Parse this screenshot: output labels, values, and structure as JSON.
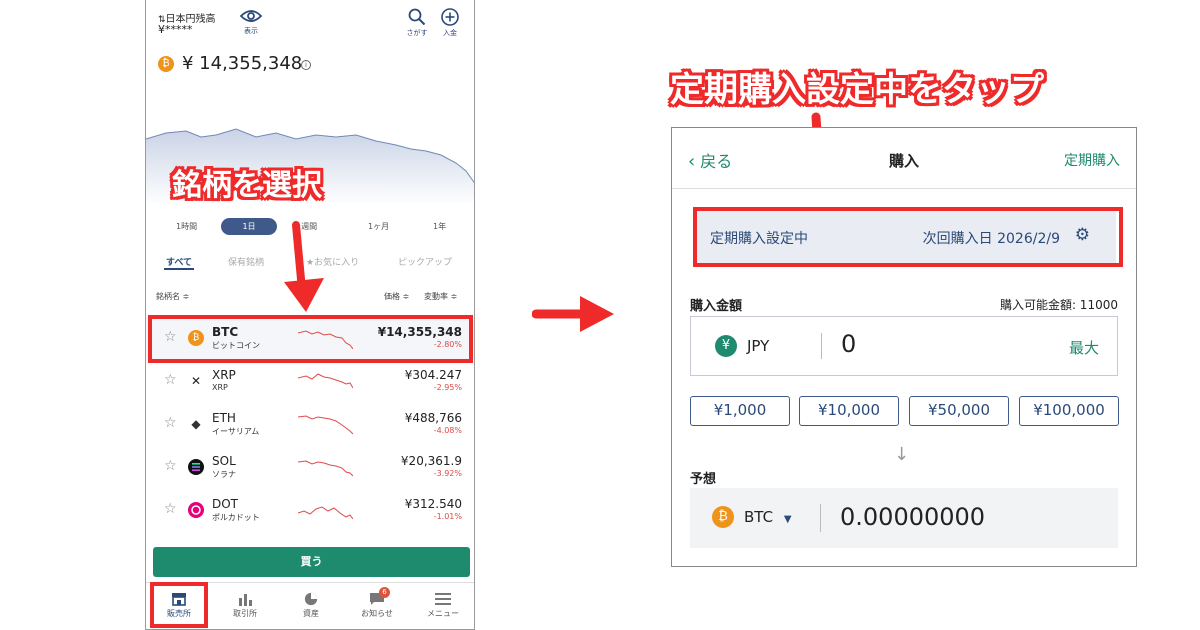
{
  "left_app": {
    "balance_label": "日本円残高",
    "balance_value": "¥*****",
    "show_label": "表示",
    "search_label": "さがす",
    "deposit_label": "入金",
    "total_value": "¥ 14,355,348",
    "timeframes": [
      "1時間",
      "1日",
      "1週間",
      "1ヶ月",
      "1年"
    ],
    "active_timeframe": "1日",
    "filters": [
      "すべて",
      "保有銘柄",
      "★お気に入り",
      "ピックアップ"
    ],
    "col_name": "銘柄名 ≑",
    "col_price": "価格 ≑",
    "col_change": "変動率 ≑",
    "coins": [
      {
        "symbol": "BTC",
        "name": "ビットコイン",
        "price": "¥14,355,348",
        "change": "-2.80%",
        "color": "#f0931a"
      },
      {
        "symbol": "XRP",
        "name": "XRP",
        "price": "¥304.247",
        "change": "-2.95%",
        "color": "#ffffff"
      },
      {
        "symbol": "ETH",
        "name": "イーサリアム",
        "price": "¥488,766",
        "change": "-4.08%",
        "color": "#ffffff"
      },
      {
        "symbol": "SOL",
        "name": "ソラナ",
        "price": "¥20,361.9",
        "change": "-3.92%",
        "color": "#111111"
      },
      {
        "symbol": "DOT",
        "name": "ポルカドット",
        "price": "¥312.540",
        "change": "-1.01%",
        "color": "#e6007a"
      }
    ],
    "buy_label": "買う",
    "nav": [
      "販売所",
      "取引所",
      "資産",
      "お知らせ",
      "メニュー"
    ],
    "notification_count": "6"
  },
  "callouts": {
    "select_coin": "銘柄を選択",
    "tap_recurring": "定期購入設定中をタップ"
  },
  "right_app": {
    "back_label": "戻る",
    "title": "購入",
    "recurring_link": "定期購入",
    "recurring_status": "定期購入設定中",
    "next_purchase": "次回購入日 2026/2/9",
    "amount_label": "購入金額",
    "available": "購入可能金額: 11000",
    "currency": "JPY",
    "amount_value": "0",
    "max_label": "最大",
    "presets": [
      "¥1,000",
      "¥10,000",
      "¥50,000",
      "¥100,000"
    ],
    "estimate_label": "予想",
    "target_currency": "BTC",
    "estimate_value": "0.00000000"
  },
  "colors": {
    "accent_green": "#1e8a6e",
    "navy": "#2b4a7a",
    "highlight_red": "#ee2a2a",
    "btc_orange": "#f0931a",
    "loss_red": "#e04a4a"
  }
}
